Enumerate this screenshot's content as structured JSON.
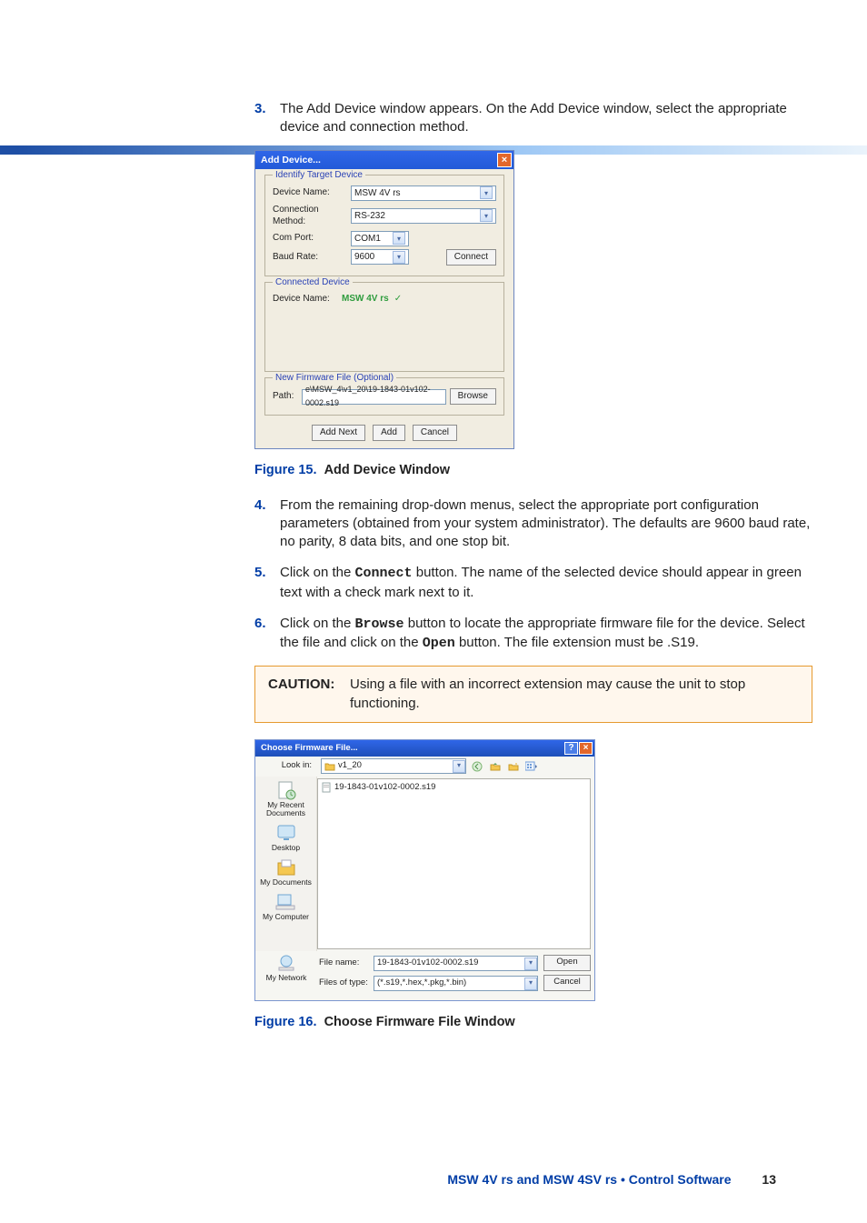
{
  "steps": {
    "s3": {
      "num": "3.",
      "text": "The Add Device window appears. On the Add Device window, select the appropriate device and connection method."
    },
    "s4": {
      "num": "4.",
      "text": "From the remaining drop-down menus, select the appropriate port configuration parameters (obtained from your system administrator). The defaults are 9600 baud rate, no parity, 8 data bits, and one stop bit."
    },
    "s5": {
      "num": "5.",
      "prefix": "Click on the ",
      "btn": "Connect",
      "suffix": " button. The name of the selected device should appear in green text with a check mark next to it."
    },
    "s6": {
      "num": "6.",
      "prefix": "Click on the ",
      "btn1": "Browse",
      "mid": " button to locate the appropriate firmware file for the device. Select the file and click on the ",
      "btn2": "Open",
      "suffix": " button. The file extension must be .S19."
    }
  },
  "fig15": {
    "label": "Figure 15.",
    "title": "Add Device Window"
  },
  "fig16": {
    "label": "Figure 16.",
    "title": "Choose Firmware File Window"
  },
  "caution": {
    "label": "CAUTION:",
    "text": "Using a file with an incorrect extension may cause the unit to stop functioning."
  },
  "add_device": {
    "title": "Add Device...",
    "identify": "Identify Target Device",
    "device_name_label": "Device Name:",
    "device_name_value": "MSW 4V rs",
    "conn_method_label": "Connection Method:",
    "conn_method_value": "RS-232",
    "com_port_label": "Com Port:",
    "com_port_value": "COM1",
    "baud_label": "Baud Rate:",
    "baud_value": "9600",
    "connect_btn": "Connect",
    "connected_title": "Connected Device",
    "connected_label": "Device Name:",
    "connected_value": "MSW 4V rs",
    "firmware_title": "New Firmware File (Optional)",
    "path_label": "Path:",
    "path_value": "e\\MSW_4\\v1_20\\19-1843-01v102-0002.s19",
    "browse_btn": "Browse",
    "add_next": "Add Next",
    "add": "Add",
    "cancel": "Cancel"
  },
  "file_dialog": {
    "title": "Choose Firmware File...",
    "look_in_label": "Look in:",
    "look_in_value": "v1_20",
    "side": {
      "recent": "My Recent Documents",
      "desktop": "Desktop",
      "mydocs": "My Documents",
      "mycomp": "My Computer",
      "mynet": "My Network"
    },
    "file_entry": "19-1843-01v102-0002.s19",
    "filename_label": "File name:",
    "filename_value": "19-1843-01v102-0002.s19",
    "filetype_label": "Files of type:",
    "filetype_value": "(*.s19,*.hex,*.pkg,*.bin)",
    "open": "Open",
    "cancel": "Cancel"
  },
  "footer": {
    "title": "MSW 4V rs and MSW 4SV rs • Control Software",
    "page": "13"
  }
}
